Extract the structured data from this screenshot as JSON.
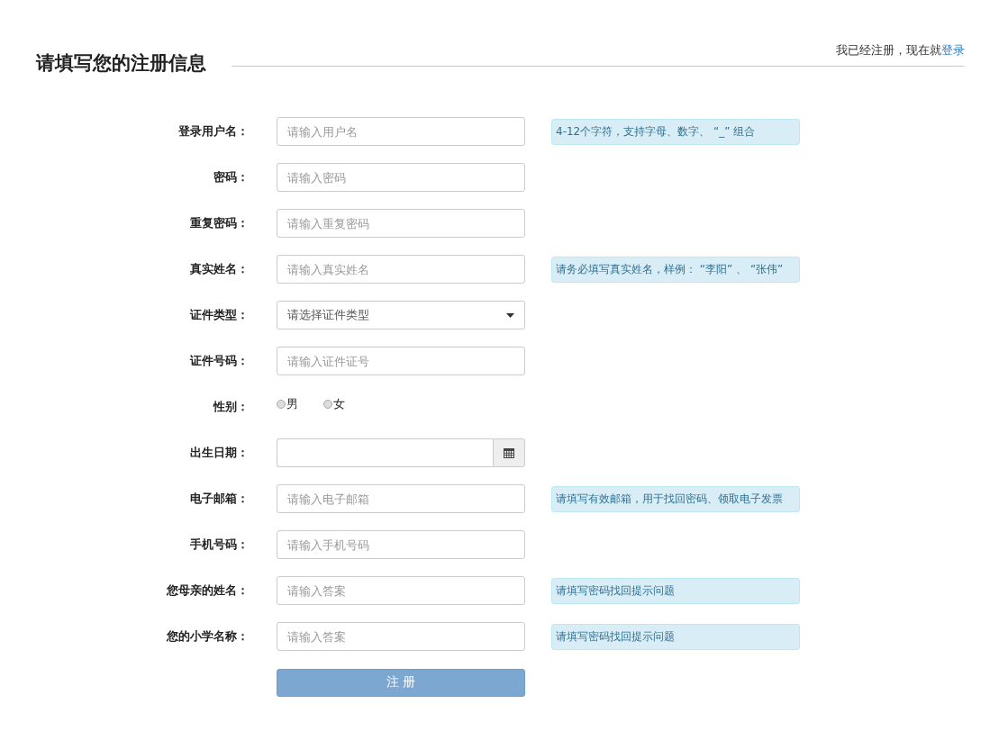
{
  "header": {
    "title": "请填写您的注册信息",
    "login_prompt": "我已经注册，现在就",
    "login_link": "登录"
  },
  "fields": [
    {
      "kind": "text",
      "label": "登录用户名：",
      "placeholder": "请输入用户名",
      "hint": "4-12个字符，支持字母、数字、 “_” 组合"
    },
    {
      "kind": "text",
      "label": "密码：",
      "placeholder": "请输入密码"
    },
    {
      "kind": "text",
      "label": "重复密码：",
      "placeholder": "请输入重复密码"
    },
    {
      "kind": "text",
      "label": "真实姓名：",
      "placeholder": "请输入真实姓名",
      "hint": "请务必填写真实姓名，样例： “李阳” 、 “张伟”"
    },
    {
      "kind": "select",
      "label": "证件类型：",
      "value": "请选择证件类型"
    },
    {
      "kind": "text",
      "label": "证件号码：",
      "placeholder": "请输入证件证号"
    },
    {
      "kind": "radio",
      "label": "性别：",
      "options": [
        {
          "label": "男",
          "selected": false
        },
        {
          "label": "女",
          "selected": false
        }
      ]
    },
    {
      "kind": "date",
      "label": "出生日期："
    },
    {
      "kind": "text",
      "label": "电子邮箱：",
      "placeholder": "请输入电子邮箱",
      "hint": "请填写有效邮箱，用于找回密码、领取电子发票"
    },
    {
      "kind": "text",
      "label": "手机号码：",
      "placeholder": "请输入手机号码"
    },
    {
      "kind": "text",
      "label": "您母亲的姓名：",
      "placeholder": "请输入答案",
      "hint": "请填写密码找回提示问题"
    },
    {
      "kind": "text",
      "label": "您的小学名称：",
      "placeholder": "请输入答案",
      "hint": "请填写密码找回提示问题"
    }
  ],
  "submit": {
    "label": "注 册"
  }
}
